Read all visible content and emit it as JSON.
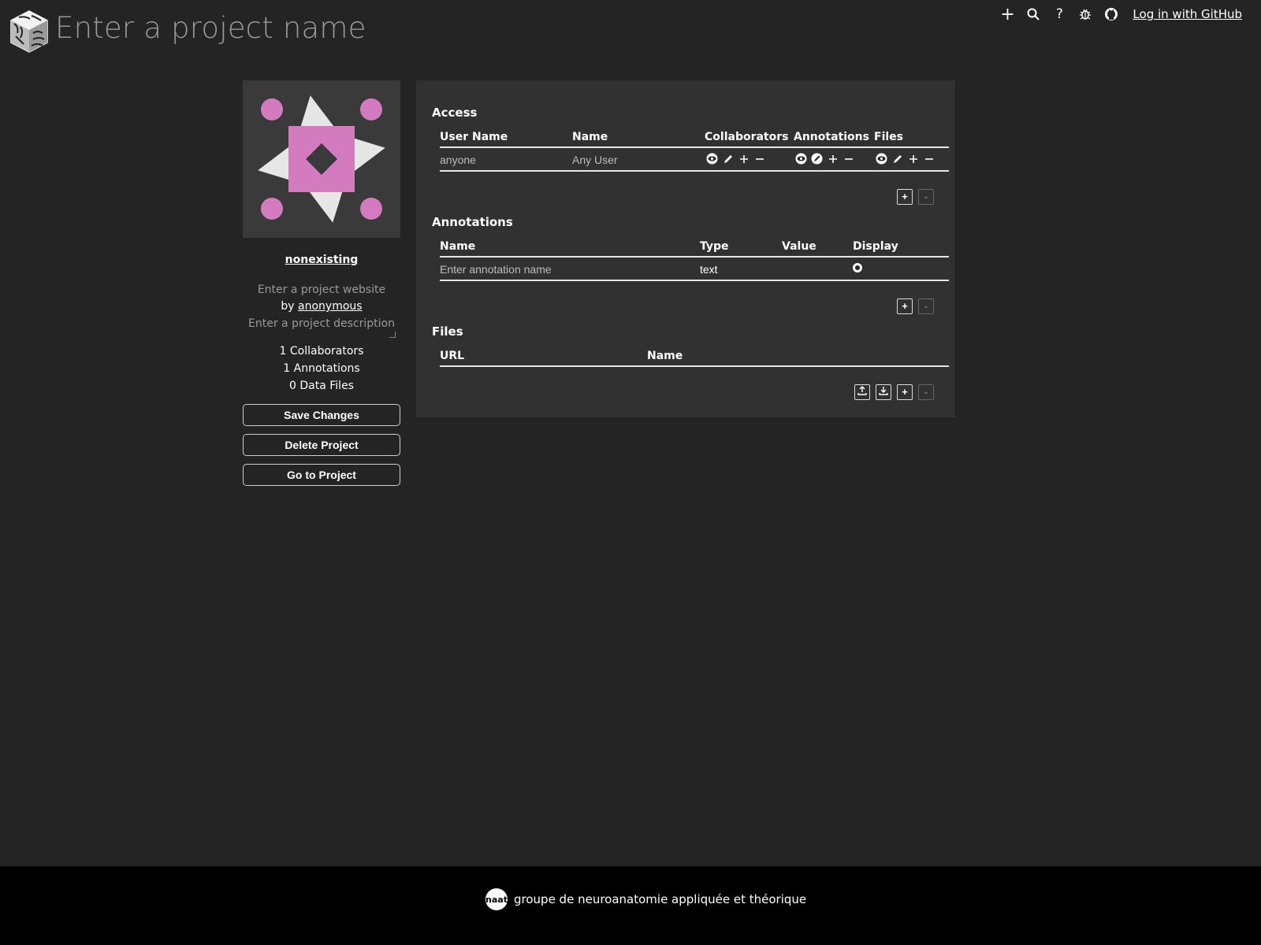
{
  "header": {
    "project_name_placeholder": "Enter a project name",
    "icons": [
      "plus-icon",
      "search-icon",
      "help-icon",
      "bug-icon",
      "github-icon"
    ],
    "icon_glyphs": {
      "plus": "+",
      "help": "?"
    },
    "login_label": "Log in with GitHub"
  },
  "sidebar": {
    "owner": "nonexisting",
    "website_placeholder": "Enter a project website",
    "by_prefix": "by",
    "author": "anonymous",
    "description_placeholder": "Enter a project description",
    "stats": {
      "collaborators": "1 Collaborators",
      "annotations": "1 Annotations",
      "files": "0 Data Files"
    },
    "buttons": {
      "save": "Save Changes",
      "delete": "Delete Project",
      "goto": "Go to Project"
    },
    "avatar_colors": {
      "accent": "#d37bbe",
      "bg": "#3a3a3a",
      "shape": "#e6e6e6",
      "center": "#3a3a3a"
    }
  },
  "access": {
    "title": "Access",
    "headers": {
      "user_name": "User Name",
      "name": "Name",
      "collaborators": "Collaborators",
      "annotations": "Annotations",
      "files": "Files"
    },
    "rows": [
      {
        "user_name": "anyone",
        "name": "Any User"
      }
    ],
    "add_label": "+",
    "remove_label": "-"
  },
  "annotations": {
    "title": "Annotations",
    "headers": {
      "name": "Name",
      "type": "Type",
      "value": "Value",
      "display": "Display"
    },
    "rows": [
      {
        "name_placeholder": "Enter annotation name",
        "type": "text",
        "value": ""
      }
    ],
    "add_label": "+",
    "remove_label": "-"
  },
  "files": {
    "title": "Files",
    "headers": {
      "url": "URL",
      "name": "Name"
    },
    "add_label": "+",
    "remove_label": "-"
  },
  "footer": {
    "badge": "naat",
    "text": "groupe de neuroanatomie appliquée et théorique"
  }
}
